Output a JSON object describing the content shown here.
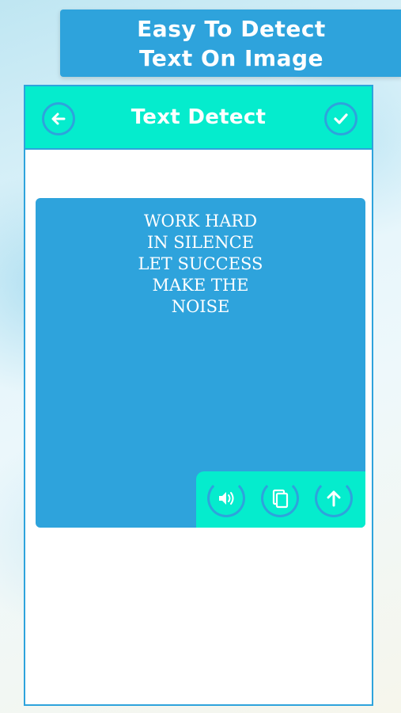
{
  "banner": {
    "line1": "Easy To Detect",
    "line2": "Text On Image"
  },
  "toolbar": {
    "title": "Text Detect",
    "back_icon": "back-arrow-icon",
    "confirm_icon": "checkmark-icon"
  },
  "detected": {
    "lines": [
      "WORK HARD",
      "IN SILENCE",
      "LET SUCCESS",
      "MAKE THE",
      "NOISE"
    ]
  },
  "actions": [
    {
      "name": "speak",
      "icon": "speaker-icon"
    },
    {
      "name": "copy",
      "icon": "copy-icon"
    },
    {
      "name": "share",
      "icon": "upload-arrow-icon"
    }
  ],
  "colors": {
    "primary": "#2ea3dc",
    "accent": "#05eccd",
    "surface": "#ffffff"
  }
}
